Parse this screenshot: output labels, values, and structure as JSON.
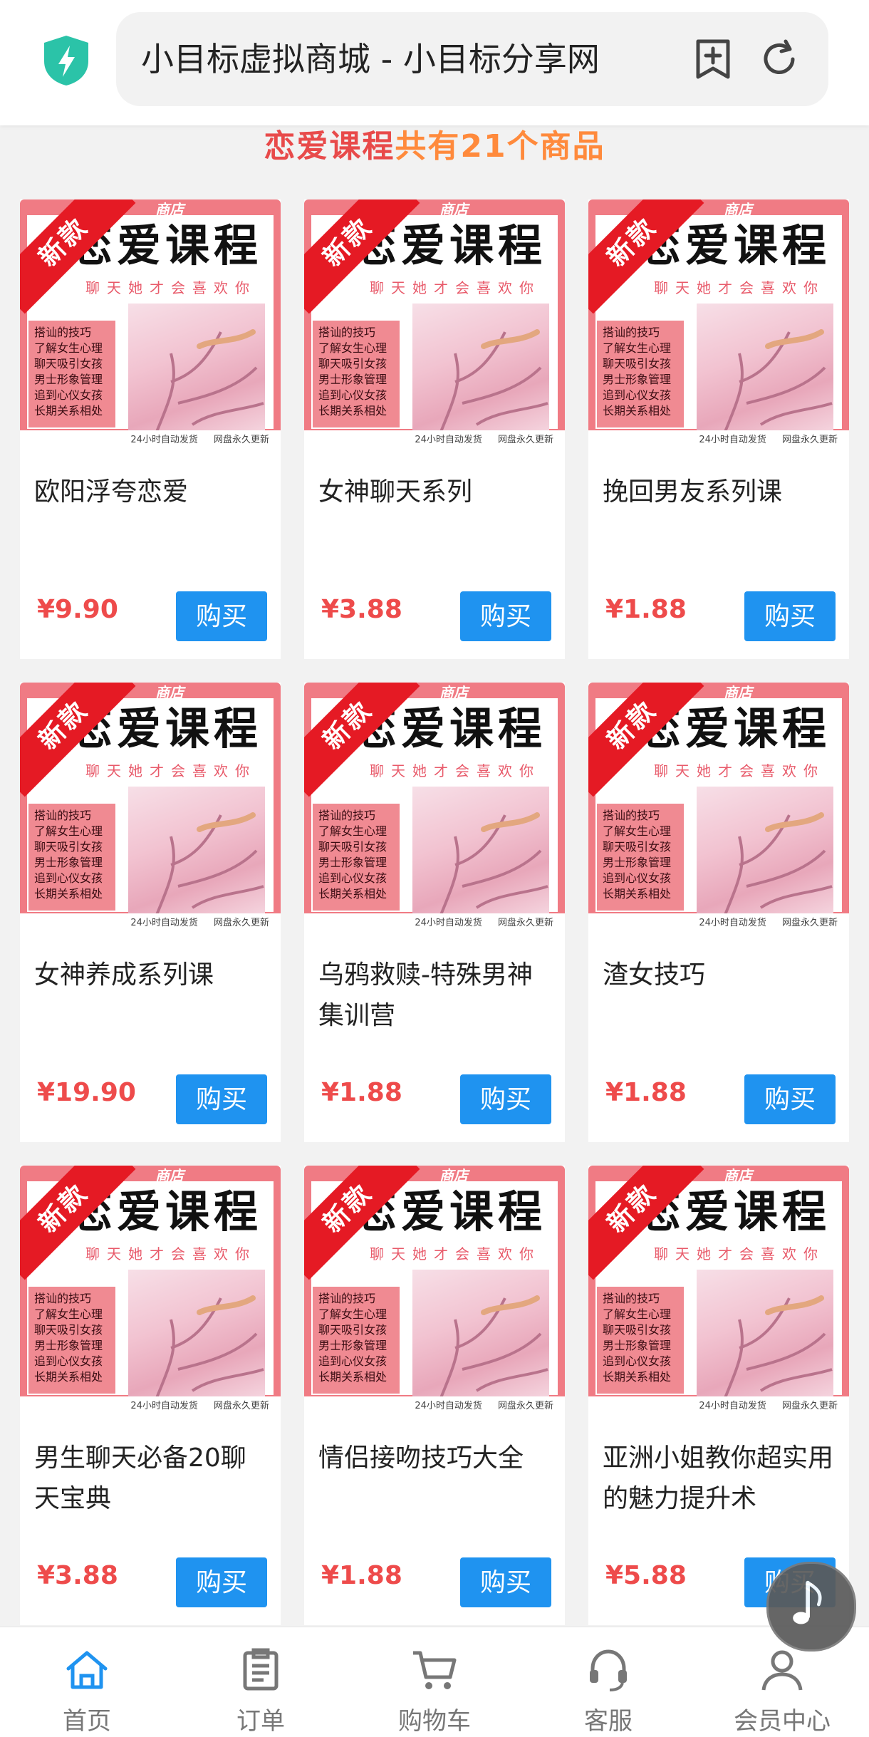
{
  "browser": {
    "title": "小目标虚拟商城 - 小目标分享网",
    "icons": [
      "shield-icon",
      "add-bookmark-icon",
      "reload-icon"
    ]
  },
  "heading": {
    "category": "恋爱课程",
    "count_text": "共有21个商品"
  },
  "thumbnail": {
    "badge": "新款",
    "shop": "商店",
    "headline": "恋爱课程",
    "subline": "聊天她才会喜欢你",
    "list": [
      "搭讪的技巧",
      "了解女生心理",
      "聊天吸引女孩",
      "男士形象管理",
      "追到心仪女孩",
      "长期关系相处"
    ],
    "footer": "24小时自动发货 网盘永久更新"
  },
  "products": [
    {
      "title": "欧阳浮夸恋爱",
      "price": "¥9.90",
      "buy": "购买"
    },
    {
      "title": "女神聊天系列",
      "price": "¥3.88",
      "buy": "购买"
    },
    {
      "title": "挽回男友系列课",
      "price": "¥1.88",
      "buy": "购买"
    },
    {
      "title": "女神养成系列课",
      "price": "¥19.90",
      "buy": "购买"
    },
    {
      "title": "乌鸦救赎-特殊男神集训营",
      "price": "¥1.88",
      "buy": "购买"
    },
    {
      "title": "渣女技巧",
      "price": "¥1.88",
      "buy": "购买"
    },
    {
      "title": "男生聊天必备20聊天宝典",
      "price": "¥3.88",
      "buy": "购买"
    },
    {
      "title": "情侣接吻技巧大全",
      "price": "¥1.88",
      "buy": "购买"
    },
    {
      "title": "亚洲小姐教你超实用的魅力提升术",
      "price": "¥5.88",
      "buy": "购买"
    }
  ],
  "nav": [
    {
      "label": "首页",
      "icon": "home-icon",
      "active": true
    },
    {
      "label": "订单",
      "icon": "order-icon",
      "active": false
    },
    {
      "label": "购物车",
      "icon": "cart-icon",
      "active": false
    },
    {
      "label": "客服",
      "icon": "headset-icon",
      "active": false
    },
    {
      "label": "会员中心",
      "icon": "user-icon",
      "active": false
    }
  ],
  "colors": {
    "accent": "#1f93f0",
    "price": "#ee4b4b",
    "heading_category": "#e84a4a",
    "heading_count": "#ff8a3c",
    "badge": "#e51a24"
  }
}
